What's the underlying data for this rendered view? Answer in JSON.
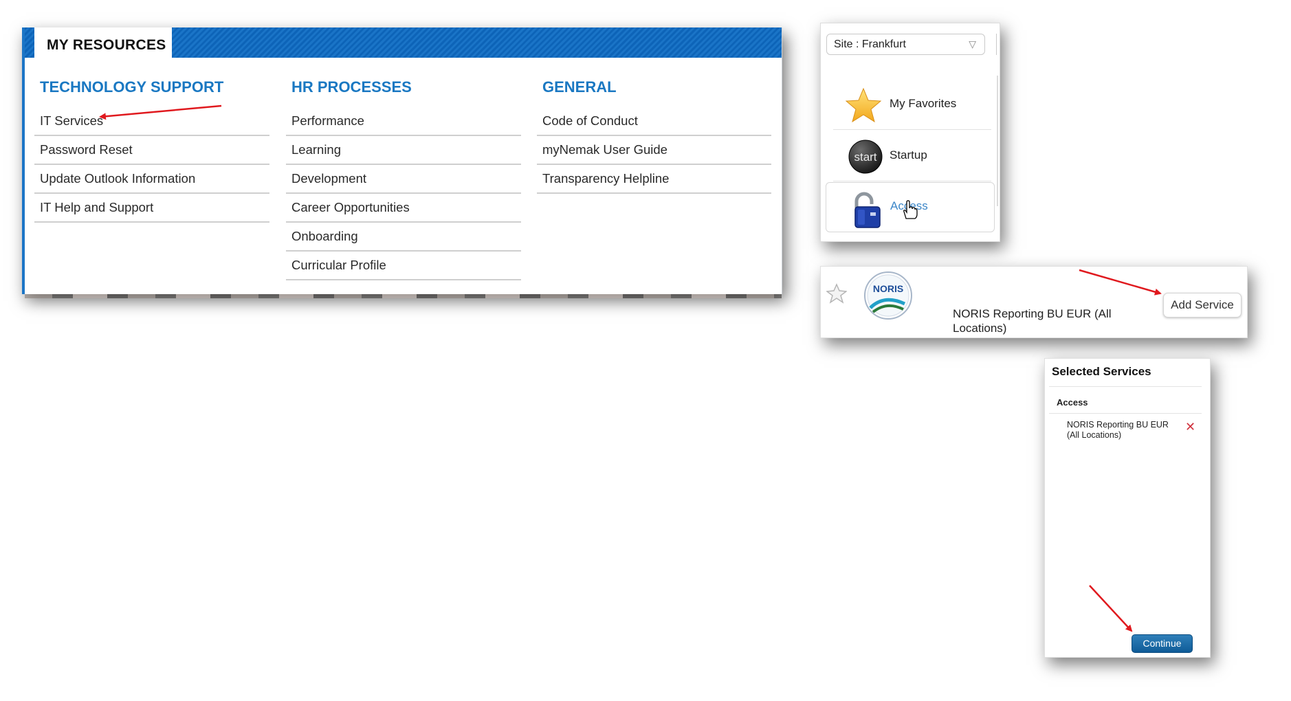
{
  "resources": {
    "tab_label": "MY RESOURCES",
    "columns": [
      {
        "title": "TECHNOLOGY SUPPORT",
        "links": [
          "IT Services",
          "Password Reset",
          "Update Outlook Information",
          "IT Help and Support"
        ]
      },
      {
        "title": "HR PROCESSES",
        "links": [
          "Performance",
          "Learning",
          "Development",
          "Career Opportunities",
          "Onboarding",
          "Curricular Profile"
        ]
      },
      {
        "title": "GENERAL",
        "links": [
          "Code of Conduct",
          "myNemak User Guide",
          "Transparency Helpline"
        ]
      }
    ]
  },
  "sidebar": {
    "site_select": "Site : Frankfurt",
    "items": [
      {
        "label": "My Favorites",
        "icon": "star-icon"
      },
      {
        "label": "Startup",
        "icon": "start-icon"
      },
      {
        "label": "Access",
        "icon": "padlock-icon"
      }
    ]
  },
  "service": {
    "logo_text": "NORIS",
    "name": "NORIS Reporting BU EUR (All Locations)",
    "add_label": "Add Service"
  },
  "selected": {
    "title": "Selected Services",
    "section": "Access",
    "item": "NORIS Reporting BU EUR (All Locations)",
    "continue_label": "Continue"
  },
  "colors": {
    "brand_blue": "#1a78c2",
    "link_active": "#3b86c8",
    "annotation_arrow": "#e0191e",
    "remove_red": "#d0313d"
  }
}
